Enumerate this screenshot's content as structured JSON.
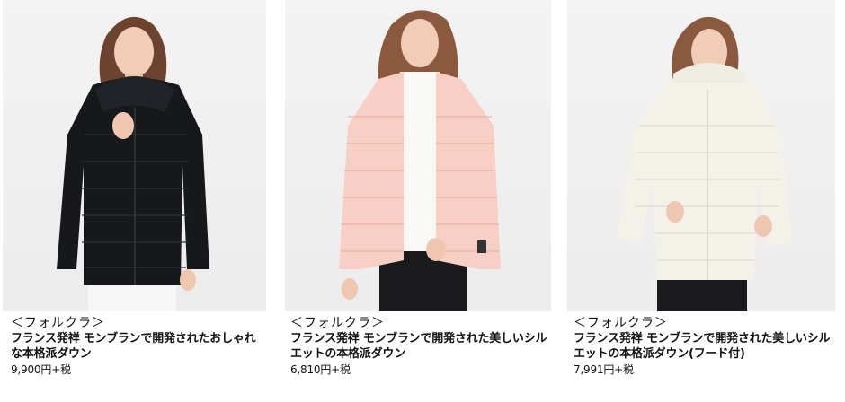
{
  "products": [
    {
      "image": "black-hooded-down-jacket",
      "coat_color": "#16181c",
      "brand": "＜フォルクラ＞",
      "description": "フランス発祥 モンブランで開発されたおしゃれな本格派ダウン",
      "price": "9,900円+税"
    },
    {
      "image": "pink-stand-collar-down-jacket",
      "coat_color": "#f7cfc4",
      "brand": "＜フォルクラ＞",
      "description": "フランス発祥 モンブランで開発された美しいシルエットの本格派ダウン",
      "price": "6,810円+税"
    },
    {
      "image": "ivory-hooded-down-jacket",
      "coat_color": "#f4f2e8",
      "brand": "＜フォルクラ＞",
      "description": "フランス発祥 モンブランで開発された美しいシルエットの本格派ダウン(フード付)",
      "price": "7,991円+税"
    }
  ]
}
